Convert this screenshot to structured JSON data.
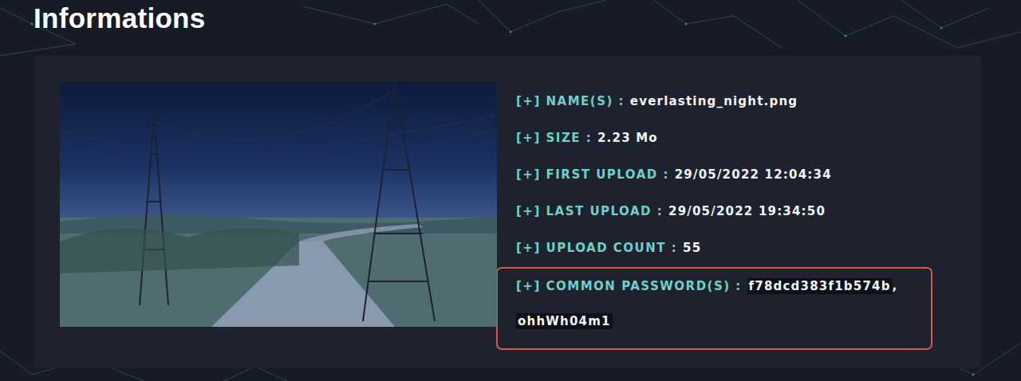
{
  "page": {
    "title": "Informations"
  },
  "info": [
    {
      "label": "[+] NAME(S) :",
      "value": "everlasting_night.png"
    },
    {
      "label": "[+] SIZE :",
      "value": "2.23 Mo"
    },
    {
      "label": "[+] FIRST UPLOAD :",
      "value": "29/05/2022 12:04:34"
    },
    {
      "label": "[+] LAST UPLOAD :",
      "value": "29/05/2022 19:34:50"
    },
    {
      "label": "[+] UPLOAD COUNT :",
      "value": "55"
    }
  ],
  "passwords": {
    "label": "[+] COMMON PASSWORD(S) :",
    "values": [
      "f78dcd383f1b574b",
      "ohhWh04m1"
    ],
    "separator": ",",
    "highlighted": true
  }
}
